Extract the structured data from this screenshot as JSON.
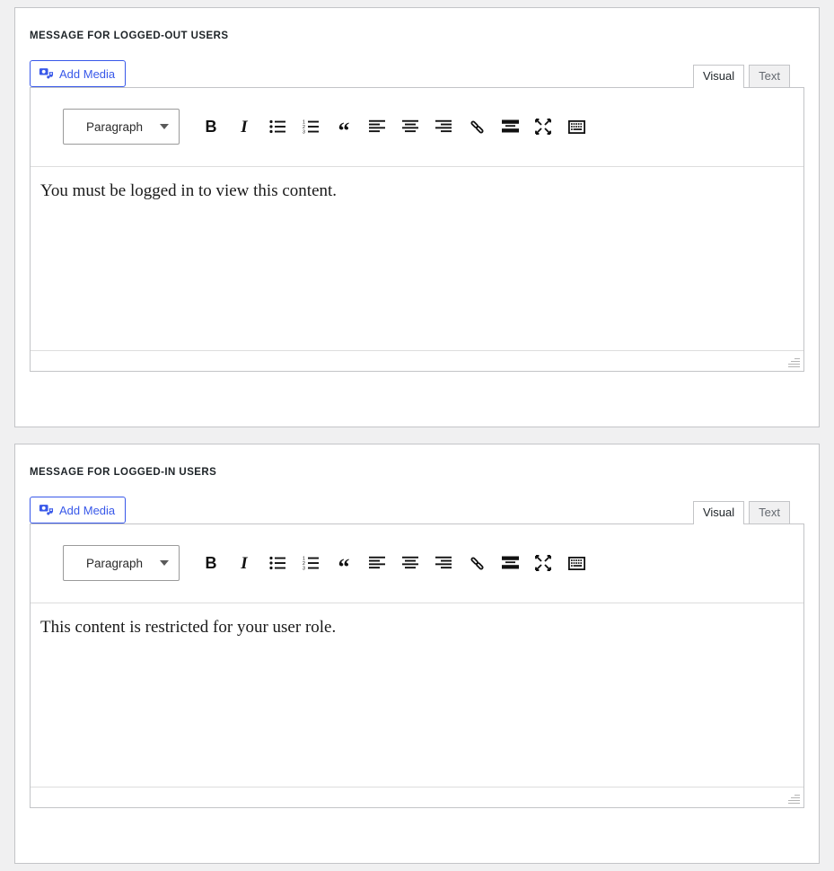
{
  "theme": {
    "page_background": "#f0f0f1",
    "panel_background": "#ffffff",
    "panel_border": "#c3c4c7",
    "accent_blue": "#3858e9",
    "text_dark": "#1d2327",
    "text_muted": "#646970"
  },
  "panels": [
    {
      "title": "MESSAGE FOR LOGGED-OUT USERS",
      "media_button": {
        "label": "Add Media",
        "icon": "admin-media-icon"
      },
      "tabs": [
        {
          "label": "Visual",
          "active": true
        },
        {
          "label": "Text",
          "active": false
        }
      ],
      "toolbar": {
        "style_select": {
          "value": "Paragraph",
          "caret_icon": "chevron-down-icon"
        },
        "buttons": [
          {
            "name": "bold-button",
            "glyph": "B",
            "title": "Bold"
          },
          {
            "name": "italic-button",
            "glyph": "I",
            "title": "Italic"
          },
          {
            "name": "bullet-list-button",
            "glyph": "",
            "title": "Bulleted list"
          },
          {
            "name": "numbered-list-button",
            "glyph": "",
            "title": "Numbered list"
          },
          {
            "name": "blockquote-button",
            "glyph": "“",
            "title": "Blockquote"
          },
          {
            "name": "align-left-button",
            "glyph": "",
            "title": "Align left"
          },
          {
            "name": "align-center-button",
            "glyph": "",
            "title": "Align center"
          },
          {
            "name": "align-right-button",
            "glyph": "",
            "title": "Align right"
          },
          {
            "name": "insert-link-button",
            "glyph": "",
            "title": "Insert/edit link"
          },
          {
            "name": "read-more-button",
            "glyph": "",
            "title": "Insert Read More tag"
          },
          {
            "name": "fullscreen-button",
            "glyph": "",
            "title": "Distraction-free writing mode"
          },
          {
            "name": "toolbar-toggle-button",
            "glyph": "",
            "title": "Toolbar Toggle"
          }
        ]
      },
      "content": "You must be logged in to view this content.",
      "statusbar": {
        "resize_handle": "resize-handle-icon"
      }
    },
    {
      "title": "MESSAGE FOR LOGGED-IN USERS",
      "media_button": {
        "label": "Add Media",
        "icon": "admin-media-icon"
      },
      "tabs": [
        {
          "label": "Visual",
          "active": true
        },
        {
          "label": "Text",
          "active": false
        }
      ],
      "toolbar": {
        "style_select": {
          "value": "Paragraph",
          "caret_icon": "chevron-down-icon"
        },
        "buttons": [
          {
            "name": "bold-button",
            "glyph": "B",
            "title": "Bold"
          },
          {
            "name": "italic-button",
            "glyph": "I",
            "title": "Italic"
          },
          {
            "name": "bullet-list-button",
            "glyph": "",
            "title": "Bulleted list"
          },
          {
            "name": "numbered-list-button",
            "glyph": "",
            "title": "Numbered list"
          },
          {
            "name": "blockquote-button",
            "glyph": "“",
            "title": "Blockquote"
          },
          {
            "name": "align-left-button",
            "glyph": "",
            "title": "Align left"
          },
          {
            "name": "align-center-button",
            "glyph": "",
            "title": "Align center"
          },
          {
            "name": "align-right-button",
            "glyph": "",
            "title": "Align right"
          },
          {
            "name": "insert-link-button",
            "glyph": "",
            "title": "Insert/edit link"
          },
          {
            "name": "read-more-button",
            "glyph": "",
            "title": "Insert Read More tag"
          },
          {
            "name": "fullscreen-button",
            "glyph": "",
            "title": "Distraction-free writing mode"
          },
          {
            "name": "toolbar-toggle-button",
            "glyph": "",
            "title": "Toolbar Toggle"
          }
        ]
      },
      "content": "This content is restricted for your user role.",
      "statusbar": {
        "resize_handle": "resize-handle-icon"
      }
    }
  ]
}
